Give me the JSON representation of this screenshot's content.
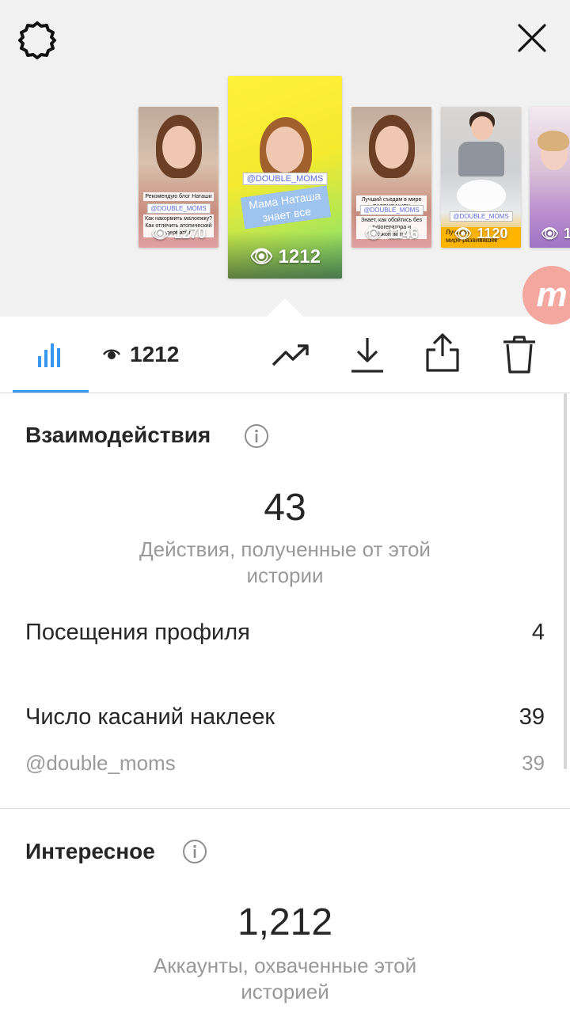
{
  "header": {
    "settings_icon": "gear-icon",
    "close_icon": "close-icon"
  },
  "stories": [
    {
      "views": "1270",
      "caption_lines": [
        "Рекомендую блог Наташи",
        "Как накормить малоежку?",
        "Как отлечить атопический дерматит"
      ],
      "tag": "@DOUBLE_MOMS"
    },
    {
      "views": "1212",
      "tag": "@DOUBLE_MOMS",
      "caption_lines": [
        "Мама Наташа",
        "знает все"
      ],
      "selected": true
    },
    {
      "views": "1146",
      "caption_lines": [
        "Лучший съедам в мире РАЗВИВАШЕК",
        "Знает, как обойтись без турогератора и сэкономить"
      ],
      "tag": "@DOUBLE_MOMS"
    },
    {
      "views": "1120",
      "caption_lines": [
        "Лучший",
        "мире развивашек"
      ],
      "tag": "@DOUBLE_MOMS"
    },
    {
      "views": "1"
    }
  ],
  "brand_badge": "m",
  "toolbar": {
    "insights_icon": "bar-chart-icon",
    "views_icon": "eye-icon",
    "views": "1212",
    "promote_icon": "trending-up-icon",
    "download_icon": "download-icon",
    "share_icon": "share-icon",
    "delete_icon": "trash-icon",
    "accent_color": "#3897f0"
  },
  "interactions": {
    "title": "Взаимодействия",
    "total": "43",
    "total_desc": "Действия, полученные от этой истории",
    "rows": [
      {
        "label": "Посещения профиля",
        "value": "4"
      },
      {
        "label": "Число касаний наклеек",
        "value": "39"
      }
    ],
    "sub_rows": [
      {
        "label": "@double_moms",
        "value": "39"
      }
    ]
  },
  "discovery": {
    "title": "Интересное",
    "total": "1,212",
    "total_desc": "Аккаунты, охваченные этой историей"
  }
}
